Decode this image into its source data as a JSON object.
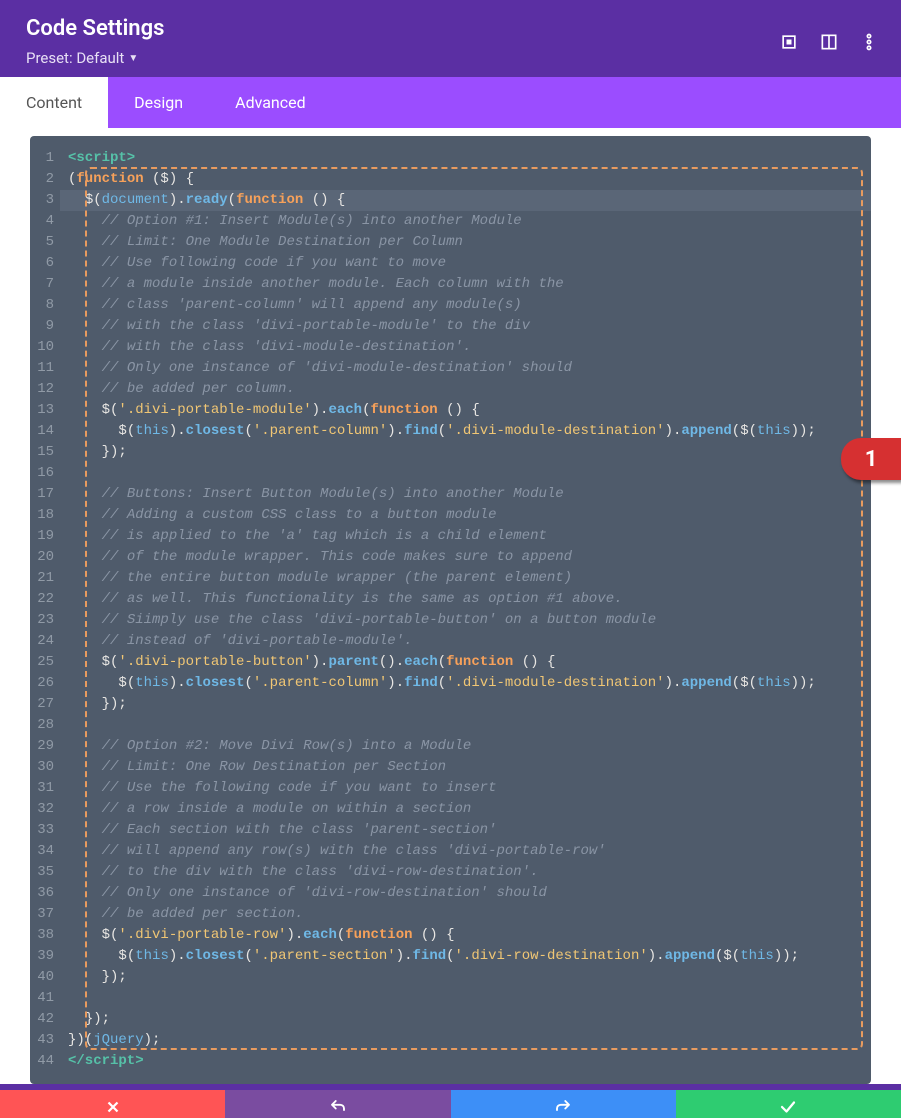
{
  "header": {
    "title": "Code Settings",
    "preset": "Preset: Default"
  },
  "tabs": [
    "Content",
    "Design",
    "Advanced"
  ],
  "activeTab": 0,
  "badge": "1",
  "code": [
    {
      "n": 1,
      "hl": false,
      "h": "<span class='t-tag'>&lt;script&gt;</span>"
    },
    {
      "n": 2,
      "hl": false,
      "h": "<span class='t-paren'>(</span><span class='t-kw'>function</span> <span class='t-paren'>($) {</span>"
    },
    {
      "n": 3,
      "hl": true,
      "h": "  <span class='t-paren'>$(</span><span class='t-doc'>document</span><span class='t-paren'>).</span><span class='t-method'>ready</span><span class='t-paren'>(</span><span class='t-kw'>function</span> <span class='t-paren'>() {</span>"
    },
    {
      "n": 4,
      "hl": false,
      "h": "    <span class='t-com'>// Option #1: Insert Module(s) into another Module</span>"
    },
    {
      "n": 5,
      "hl": false,
      "h": "    <span class='t-com'>// Limit: One Module Destination per Column</span>"
    },
    {
      "n": 6,
      "hl": false,
      "h": "    <span class='t-com'>// Use following code if you want to move</span>"
    },
    {
      "n": 7,
      "hl": false,
      "h": "    <span class='t-com'>// a module inside another module. Each column with the</span>"
    },
    {
      "n": 8,
      "hl": false,
      "h": "    <span class='t-com'>// class 'parent-column' will append any module(s)</span>"
    },
    {
      "n": 9,
      "hl": false,
      "h": "    <span class='t-com'>// with the class 'divi-portable-module' to the div</span>"
    },
    {
      "n": 10,
      "hl": false,
      "h": "    <span class='t-com'>// with the class 'divi-module-destination'.</span>"
    },
    {
      "n": 11,
      "hl": false,
      "h": "    <span class='t-com'>// Only one instance of 'divi-module-destination' should</span>"
    },
    {
      "n": 12,
      "hl": false,
      "h": "    <span class='t-com'>// be added per column.</span>"
    },
    {
      "n": 13,
      "hl": false,
      "h": "    <span class='t-paren'>$(</span><span class='t-str'>'.divi-portable-module'</span><span class='t-paren'>).</span><span class='t-method'>each</span><span class='t-paren'>(</span><span class='t-kw'>function</span> <span class='t-paren'>() {</span>"
    },
    {
      "n": 14,
      "hl": false,
      "h": "      <span class='t-paren'>$(</span><span class='t-this'>this</span><span class='t-paren'>).</span><span class='t-method'>closest</span><span class='t-paren'>(</span><span class='t-str'>'.parent-column'</span><span class='t-paren'>).</span><span class='t-method'>find</span><span class='t-paren'>(</span><span class='t-str'>'.divi-module-destination'</span><span class='t-paren'>).</span><span class='t-method'>append</span><span class='t-paren'>($(</span><span class='t-this'>this</span><span class='t-paren'>));</span>"
    },
    {
      "n": 15,
      "hl": false,
      "h": "    <span class='t-paren'>});</span>"
    },
    {
      "n": 16,
      "hl": false,
      "h": ""
    },
    {
      "n": 17,
      "hl": false,
      "h": "    <span class='t-com'>// Buttons: Insert Button Module(s) into another Module</span>"
    },
    {
      "n": 18,
      "hl": false,
      "h": "    <span class='t-com'>// Adding a custom CSS class to a button module</span>"
    },
    {
      "n": 19,
      "hl": false,
      "h": "    <span class='t-com'>// is applied to the 'a' tag which is a child element</span>"
    },
    {
      "n": 20,
      "hl": false,
      "h": "    <span class='t-com'>// of the module wrapper. This code makes sure to append</span>"
    },
    {
      "n": 21,
      "hl": false,
      "h": "    <span class='t-com'>// the entire button module wrapper (the parent element)</span>"
    },
    {
      "n": 22,
      "hl": false,
      "h": "    <span class='t-com'>// as well. This functionality is the same as option #1 above.</span>"
    },
    {
      "n": 23,
      "hl": false,
      "h": "    <span class='t-com'>// Siimply use the class 'divi-portable-button' on a button module</span>"
    },
    {
      "n": 24,
      "hl": false,
      "h": "    <span class='t-com'>// instead of 'divi-portable-module'.</span>"
    },
    {
      "n": 25,
      "hl": false,
      "h": "    <span class='t-paren'>$(</span><span class='t-str'>'.divi-portable-button'</span><span class='t-paren'>).</span><span class='t-method'>parent</span><span class='t-paren'>().</span><span class='t-method'>each</span><span class='t-paren'>(</span><span class='t-kw'>function</span> <span class='t-paren'>() {</span>"
    },
    {
      "n": 26,
      "hl": false,
      "h": "      <span class='t-paren'>$(</span><span class='t-this'>this</span><span class='t-paren'>).</span><span class='t-method'>closest</span><span class='t-paren'>(</span><span class='t-str'>'.parent-column'</span><span class='t-paren'>).</span><span class='t-method'>find</span><span class='t-paren'>(</span><span class='t-str'>'.divi-module-destination'</span><span class='t-paren'>).</span><span class='t-method'>append</span><span class='t-paren'>($(</span><span class='t-this'>this</span><span class='t-paren'>));</span>"
    },
    {
      "n": 27,
      "hl": false,
      "h": "    <span class='t-paren'>});</span>"
    },
    {
      "n": 28,
      "hl": false,
      "h": ""
    },
    {
      "n": 29,
      "hl": false,
      "h": "    <span class='t-com'>// Option #2: Move Divi Row(s) into a Module</span>"
    },
    {
      "n": 30,
      "hl": false,
      "h": "    <span class='t-com'>// Limit: One Row Destination per Section</span>"
    },
    {
      "n": 31,
      "hl": false,
      "h": "    <span class='t-com'>// Use the following code if you want to insert</span>"
    },
    {
      "n": 32,
      "hl": false,
      "h": "    <span class='t-com'>// a row inside a module on within a section</span>"
    },
    {
      "n": 33,
      "hl": false,
      "h": "    <span class='t-com'>// Each section with the class 'parent-section'</span>"
    },
    {
      "n": 34,
      "hl": false,
      "h": "    <span class='t-com'>// will append any row(s) with the class 'divi-portable-row'</span>"
    },
    {
      "n": 35,
      "hl": false,
      "h": "    <span class='t-com'>// to the div with the class 'divi-row-destination'.</span>"
    },
    {
      "n": 36,
      "hl": false,
      "h": "    <span class='t-com'>// Only one instance of 'divi-row-destination' should</span>"
    },
    {
      "n": 37,
      "hl": false,
      "h": "    <span class='t-com'>// be added per section.</span>"
    },
    {
      "n": 38,
      "hl": false,
      "h": "    <span class='t-paren'>$(</span><span class='t-str'>'.divi-portable-row'</span><span class='t-paren'>).</span><span class='t-method'>each</span><span class='t-paren'>(</span><span class='t-kw'>function</span> <span class='t-paren'>() {</span>"
    },
    {
      "n": 39,
      "hl": false,
      "h": "      <span class='t-paren'>$(</span><span class='t-this'>this</span><span class='t-paren'>).</span><span class='t-method'>closest</span><span class='t-paren'>(</span><span class='t-str'>'.parent-section'</span><span class='t-paren'>).</span><span class='t-method'>find</span><span class='t-paren'>(</span><span class='t-str'>'.divi-row-destination'</span><span class='t-paren'>).</span><span class='t-method'>append</span><span class='t-paren'>($(</span><span class='t-this'>this</span><span class='t-paren'>));</span>"
    },
    {
      "n": 40,
      "hl": false,
      "h": "    <span class='t-paren'>});</span>"
    },
    {
      "n": 41,
      "hl": false,
      "h": ""
    },
    {
      "n": 42,
      "hl": false,
      "h": "  <span class='t-paren'>});</span>"
    },
    {
      "n": 43,
      "hl": false,
      "h": "<span class='t-paren'>})(</span><span class='t-doc'>jQuery</span><span class='t-paren'>);</span>"
    },
    {
      "n": 44,
      "hl": false,
      "h": "<span class='t-tag'>&lt;/script&gt;</span>"
    }
  ]
}
